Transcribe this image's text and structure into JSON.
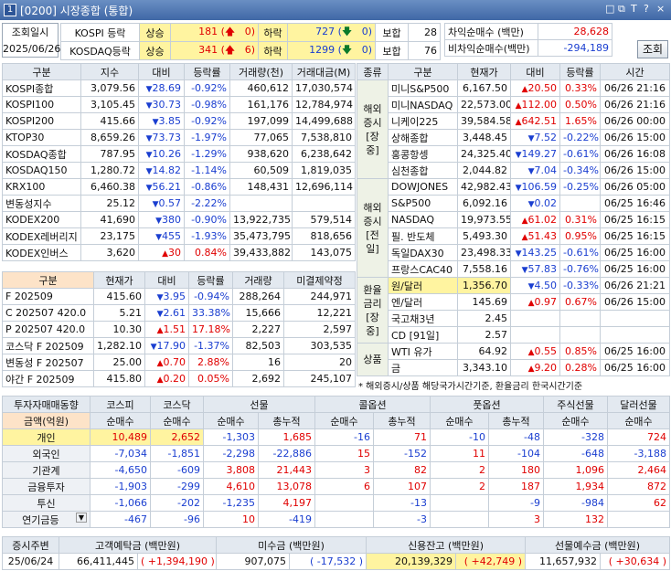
{
  "window": {
    "num": "1",
    "title": "[0200] 시장종합 (통합)",
    "icons": [
      "□",
      "⧉",
      "T",
      "?",
      "×"
    ]
  },
  "top": {
    "date_label": "조회일시",
    "date": "2025/06/26",
    "rows": [
      {
        "market": "KOSPI 등락",
        "up_label": "상승",
        "up": "181",
        "up2": "0",
        "down_label": "하락",
        "down": "727",
        "down2": "0",
        "hold_label": "보합",
        "hold": "28"
      },
      {
        "market": "KOSDAQ등락",
        "up_label": "상승",
        "up": "341",
        "up2": "6",
        "down_label": "하락",
        "down": "1299",
        "down2": "0",
        "hold_label": "보합",
        "hold": "76"
      }
    ],
    "diff": [
      {
        "label": "차익순매수 (백만)",
        "value": "28,628"
      },
      {
        "label": "비차익순매수(백만)",
        "value": "-294,189"
      }
    ],
    "query_button": "조회"
  },
  "index_table": {
    "headers": [
      "구분",
      "지수",
      "대비",
      "등락률",
      "거래량(천)",
      "거래대금(M)"
    ],
    "rows": [
      [
        "KOSPI종합",
        "3,079.56",
        "dn",
        "28.69",
        "-0.92%",
        "460,612",
        "17,030,574"
      ],
      [
        "KOSPI100",
        "3,105.45",
        "dn",
        "30.73",
        "-0.98%",
        "161,176",
        "12,784,974"
      ],
      [
        "KOSPI200",
        "415.66",
        "dn",
        "3.85",
        "-0.92%",
        "197,099",
        "14,499,688"
      ],
      [
        "KTOP30",
        "8,659.26",
        "dn",
        "73.73",
        "-1.97%",
        "77,065",
        "7,538,810"
      ],
      [
        "KOSDAQ종합",
        "787.95",
        "dn",
        "10.26",
        "-1.29%",
        "938,620",
        "6,238,642"
      ],
      [
        "KOSDAQ150",
        "1,280.72",
        "dn",
        "14.82",
        "-1.14%",
        "60,509",
        "1,819,035"
      ],
      [
        "KRX100",
        "6,460.38",
        "dn",
        "56.21",
        "-0.86%",
        "148,431",
        "12,696,114"
      ],
      [
        "변동성지수",
        "25.12",
        "dn",
        "0.57",
        "-2.22%",
        "",
        ""
      ],
      [
        "KODEX200",
        "41,690",
        "dn",
        "380",
        "-0.90%",
        "13,922,735",
        "579,514"
      ],
      [
        "KODEX레버리지",
        "23,175",
        "dn",
        "455",
        "-1.93%",
        "35,473,795",
        "818,656"
      ],
      [
        "KODEX인버스",
        "3,620",
        "up",
        "30",
        "0.84%",
        "39,433,882",
        "143,075"
      ]
    ]
  },
  "futures_table": {
    "headers": [
      "구분",
      "현재가",
      "대비",
      "등락률",
      "거래량",
      "미결제약정"
    ],
    "rows": [
      [
        "F 202509",
        "415.60",
        "dn",
        "3.95",
        "-0.94%",
        "288,264",
        "244,971"
      ],
      [
        "C 202507 420.0",
        "5.21",
        "dn",
        "2.61",
        "33.38%",
        "15,666",
        "12,221"
      ],
      [
        "P 202507 420.0",
        "10.30",
        "up",
        "1.51",
        "17.18%",
        "2,227",
        "2,597"
      ],
      [
        "코스닥 F 202509",
        "1,282.10",
        "dn",
        "17.90",
        "-1.37%",
        "82,503",
        "303,535"
      ],
      [
        "변동성 F 202507",
        "25.00",
        "up",
        "0.70",
        "2.88%",
        "16",
        "20"
      ],
      [
        "야간 F 202509",
        "415.80",
        "up",
        "0.20",
        "0.05%",
        "2,692",
        "245,107"
      ]
    ]
  },
  "world_table": {
    "headers": [
      "종류",
      "구분",
      "현재가",
      "대비",
      "등락률",
      "시간"
    ],
    "groups": [
      {
        "label": "해외\n증시\n[장중]",
        "rows": [
          [
            "미니S&P500",
            "6,167.50",
            "up",
            "20.50",
            "0.33%",
            "06/26 21:16"
          ],
          [
            "미니NASDAQ",
            "22,573.00",
            "up",
            "112.00",
            "0.50%",
            "06/26 21:16"
          ],
          [
            "니케이225",
            "39,584.58",
            "up",
            "642.51",
            "1.65%",
            "06/26 00:00"
          ],
          [
            "상해종합",
            "3,448.45",
            "dn",
            "7.52",
            "-0.22%",
            "06/26 15:00"
          ],
          [
            "홍콩항셍",
            "24,325.40",
            "dn",
            "149.27",
            "-0.61%",
            "06/26 16:08"
          ],
          [
            "심천종합",
            "2,044.82",
            "dn",
            "7.04",
            "-0.34%",
            "06/26 15:00"
          ]
        ]
      },
      {
        "label": "해외\n증시\n[전일]",
        "rows": [
          [
            "DOWJONES",
            "42,982.43",
            "dn",
            "106.59",
            "-0.25%",
            "06/26 05:00"
          ],
          [
            "S&P500",
            "6,092.16",
            "dn",
            "0.02",
            "",
            "06/25 16:46"
          ],
          [
            "NASDAQ",
            "19,973.55",
            "up",
            "61.02",
            "0.31%",
            "06/25 16:15"
          ],
          [
            "필. 반도체",
            "5,493.30",
            "up",
            "51.43",
            "0.95%",
            "06/25 16:15"
          ],
          [
            "독일DAX30",
            "23,498.33",
            "dn",
            "143.25",
            "-0.61%",
            "06/25 16:00"
          ],
          [
            "프랑스CAC40",
            "7,558.16",
            "dn",
            "57.83",
            "-0.76%",
            "06/25 16:00"
          ]
        ]
      },
      {
        "label": "환율\n금리\n[장중]",
        "rows": [
          [
            "원/달러",
            "1,356.70",
            "dn",
            "4.50",
            "-0.33%",
            "06/26 21:21"
          ],
          [
            "엔/달러",
            "145.69",
            "up",
            "0.97",
            "0.67%",
            "06/26 15:00"
          ],
          [
            "국고채3년",
            "2.45",
            "",
            "",
            "",
            ""
          ],
          [
            "CD [91일]",
            "2.57",
            "",
            "",
            "",
            ""
          ]
        ]
      },
      {
        "label": "상품",
        "rows": [
          [
            "WTI 유가",
            "64.92",
            "up",
            "0.55",
            "0.85%",
            "06/25 16:00"
          ],
          [
            "금",
            "3,343.10",
            "up",
            "9.20",
            "0.28%",
            "06/25 16:00"
          ]
        ]
      }
    ],
    "note": "* 해외증시/상품 해당국가시간기준, 환율금리 한국시간기준"
  },
  "investor_table": {
    "header_top": [
      "투자자매매동향",
      "코스피",
      "코스닥",
      "선물",
      "",
      "콜옵션",
      "",
      "풋옵션",
      "",
      "주식선물",
      "달러선물"
    ],
    "header_sub": [
      "금액(억원)",
      "순매수",
      "순매수",
      "순매수",
      "총누적",
      "순매수",
      "총누적",
      "순매수",
      "총누적",
      "순매수",
      "순매수"
    ],
    "rows": [
      [
        "개인",
        "10,489",
        "2,652",
        "-1,303",
        "1,685",
        "-16",
        "71",
        "-10",
        "-48",
        "-328",
        "724"
      ],
      [
        "외국인",
        "-7,034",
        "-1,851",
        "-2,298",
        "-22,886",
        "15",
        "-152",
        "11",
        "-104",
        "-648",
        "-3,188"
      ],
      [
        "기관계",
        "-4,650",
        "-609",
        "3,808",
        "21,443",
        "3",
        "82",
        "2",
        "180",
        "1,096",
        "2,464"
      ],
      [
        "금융투자",
        "-1,903",
        "-299",
        "4,610",
        "13,078",
        "6",
        "107",
        "2",
        "187",
        "1,934",
        "872"
      ],
      [
        "투신",
        "-1,066",
        "-202",
        "-1,235",
        "4,197",
        "",
        "-13",
        "",
        "-9",
        "-984",
        "62"
      ],
      [
        "연기금등",
        "-467",
        "-96",
        "10",
        "-419",
        "",
        "-3",
        "",
        "3",
        "132",
        ""
      ]
    ]
  },
  "bottom": {
    "headers": [
      "증시주변",
      "고객예탁금 (백만원)",
      "",
      "미수금 (백만원)",
      "",
      "신용잔고 (백만원)",
      "",
      "선물예수금 (백만원)",
      ""
    ],
    "values": [
      "25/06/24",
      "66,411,445",
      "+1,394,190",
      "907,075",
      "-17,532",
      "20,139,329",
      "+42,749",
      "11,657,932",
      "+30,634"
    ]
  }
}
